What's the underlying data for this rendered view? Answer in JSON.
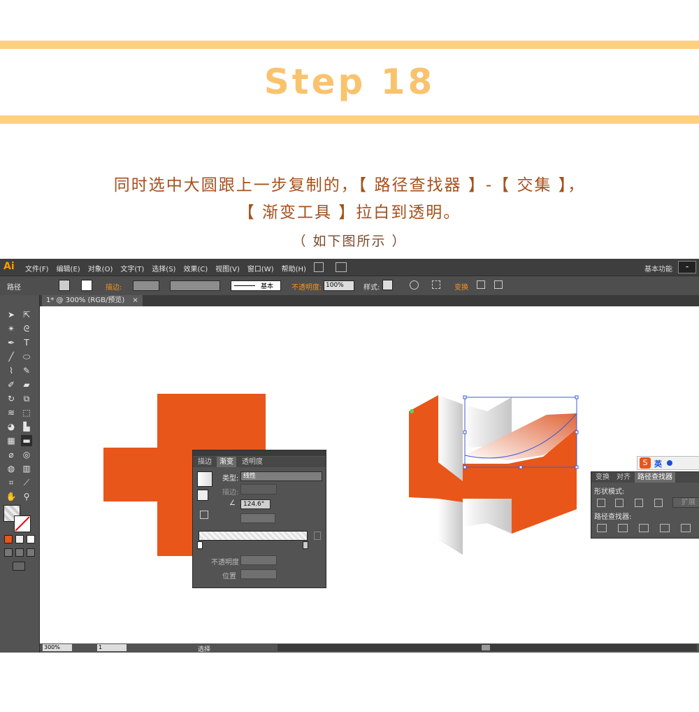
{
  "header": {
    "title": "Step 18",
    "line1": "同时选中大圆跟上一步复制的，【 路径查找器 】-【 交集 】，",
    "line2": "【 渐变工具 】拉白到透明。",
    "note": "（ 如下图所示 ）"
  },
  "colors": {
    "band": "#fdd082",
    "title": "#f9c36e",
    "text": "#a5501c",
    "accent": "#e8561a"
  },
  "app": {
    "logo": "Ai",
    "menus": [
      "文件(F)",
      "编辑(E)",
      "对象(O)",
      "文字(T)",
      "选择(S)",
      "效果(C)",
      "视图(V)",
      "窗口(W)",
      "帮助(H)"
    ],
    "workspace": "基本功能",
    "window_button": "-"
  },
  "control_bar": {
    "object_type": "路径",
    "stroke_label": "描边:",
    "brush_label": "基本",
    "opacity_label": "不透明度:",
    "opacity_value": "100%",
    "style_label": "样式:",
    "transform_label": "变换"
  },
  "document": {
    "tab": "1* @ 300% (RGB/预览)",
    "close": "×"
  },
  "gradient_panel": {
    "tabs": [
      "描边",
      "渐变",
      "透明度"
    ],
    "active_tab": 1,
    "type_label": "类型:",
    "type_value": "线性",
    "stroke_label": "描边:",
    "angle_value": "124.6°",
    "opacity_label": "不透明度",
    "position_label": "位置"
  },
  "pathfinder_panel": {
    "tabs": [
      "变换",
      "对齐",
      "路径查找器"
    ],
    "active_tab": 2,
    "shape_modes_label": "形状模式:",
    "pathfinders_label": "路径查找器:",
    "expand_label": "扩展"
  },
  "ime": {
    "label": "英"
  },
  "status": {
    "zoom": "300%",
    "artboard": "1",
    "tool": "选择"
  }
}
